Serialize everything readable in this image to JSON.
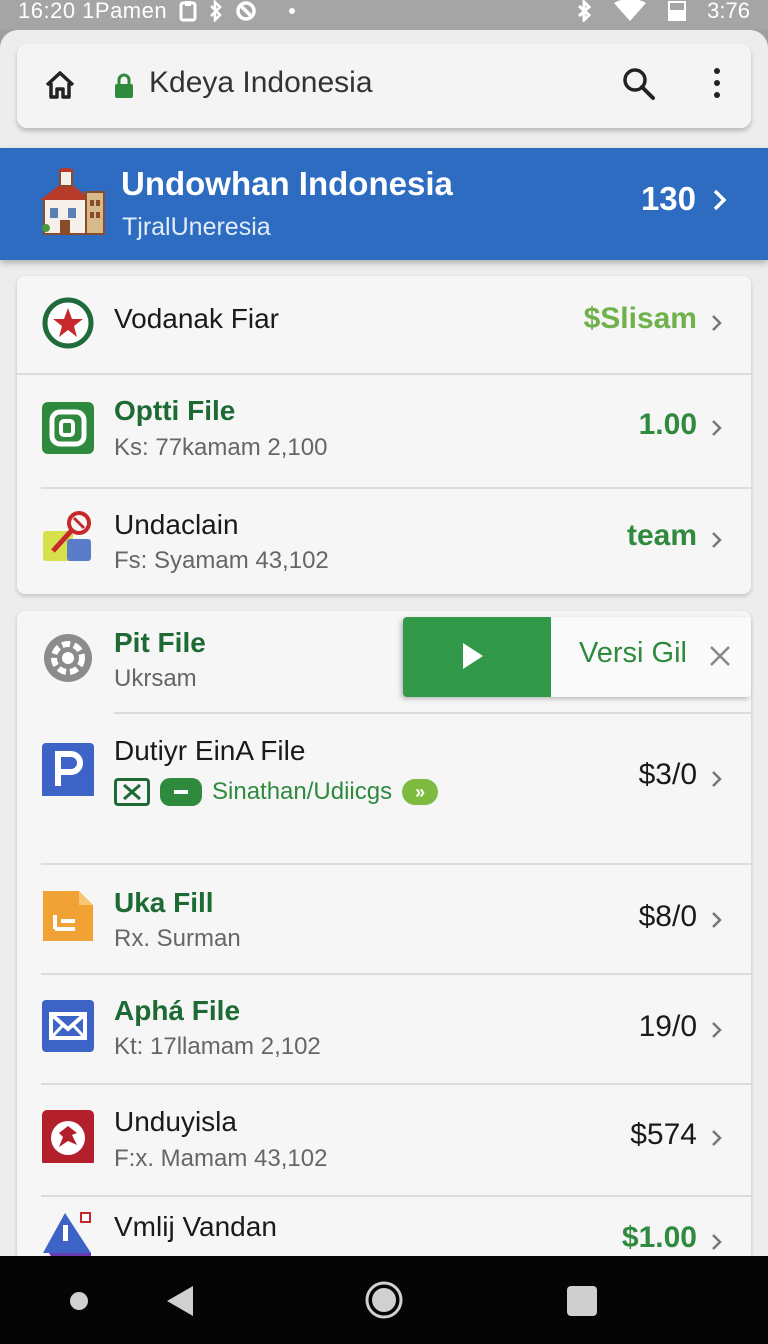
{
  "status_bar": {
    "left_text": "16:20 1Pamen",
    "right_text": "3:76"
  },
  "address_bar": {
    "title": "Kdeya Indonesia",
    "icons": [
      "home-icon",
      "lock-icon",
      "search-icon",
      "more-vert-icon"
    ]
  },
  "banner": {
    "title": "Undowhan Indonesia",
    "subtitle": "TjralUneresia",
    "count": "130"
  },
  "card1": {
    "rows": [
      {
        "title": "Vodanak Fiar",
        "value": "$Slisam",
        "icon": "red-star-circle-icon"
      },
      {
        "title": "Optti File",
        "subtitle": "Ks: 77kamam 2,100",
        "value": "1.00",
        "icon": "green-square-icon"
      },
      {
        "title": "Undaclain",
        "subtitle": "Fs: Syamam 43,102",
        "value": "team",
        "icon": "key-icon"
      }
    ]
  },
  "card2": {
    "swipe_row": {
      "title": "Pit File",
      "subtitle": "Ukrsam",
      "action_label": "Versi Gil",
      "icon": "gear-icon"
    },
    "rows": [
      {
        "title": "Dutiyr EinA File",
        "tag_text": "Sinathan/Udiicgs",
        "value": "$3/0",
        "icon": "p-icon"
      },
      {
        "title": "Uka Fill",
        "subtitle": "Rx. Surman",
        "value": "$8/0",
        "icon": "document-icon"
      },
      {
        "title": "Aphá File",
        "subtitle": "Kt: 17llamam 2,102",
        "value": "19/0",
        "icon": "mail-icon"
      },
      {
        "title": "Unduyisla",
        "subtitle": "F:x. Mamam 43,102",
        "value": "$574",
        "icon": "red-badge-icon"
      },
      {
        "title": "Vmlij Vandan",
        "value": "$1.00",
        "icon": "warning-triangle-icon"
      }
    ]
  },
  "colors": {
    "banner": "#2d6cc0",
    "green": "#2f8a3e",
    "dark_green": "#1d6a34",
    "light_green": "#6fb14a"
  }
}
